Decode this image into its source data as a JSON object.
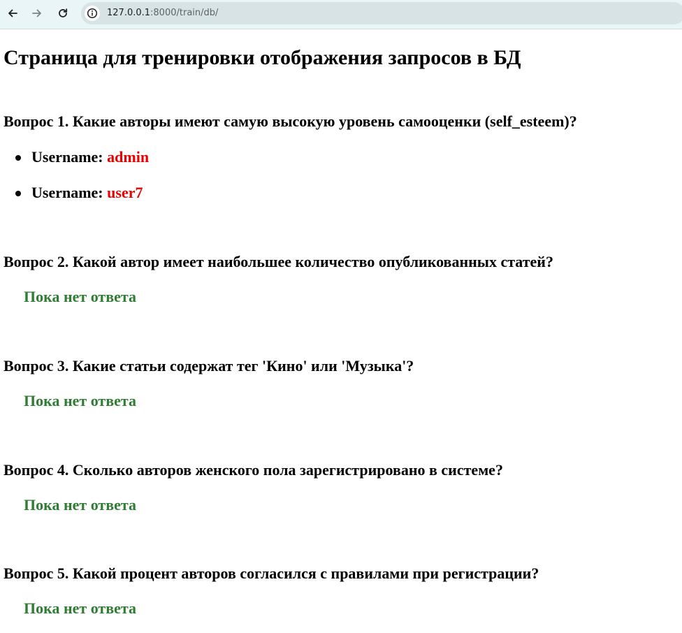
{
  "browser": {
    "url_host": "127.0.0.1",
    "url_path": ":8000/train/db/"
  },
  "page": {
    "title": "Страница для тренировки отображения запросов в БД",
    "username_label": "Username:",
    "no_answer": "Пока нет ответа",
    "colors": {
      "username_value": "#ee0000",
      "no_answer": "#2e7d32"
    }
  },
  "questions": [
    {
      "text": "Вопрос 1. Какие авторы имеют самую высокую уровень самооценки (self_esteem)?",
      "answers": [
        "admin",
        "user7"
      ]
    },
    {
      "text": "Вопрос 2. Какой автор имеет наибольшее количество опубликованных статей?"
    },
    {
      "text": "Вопрос 3. Какие статьи содержат тег 'Кино' или 'Музыка'?"
    },
    {
      "text": "Вопрос 4. Сколько авторов женского пола зарегистрировано в системе?"
    },
    {
      "text": "Вопрос 5. Какой процент авторов согласился с правилами при регистрации?"
    }
  ]
}
